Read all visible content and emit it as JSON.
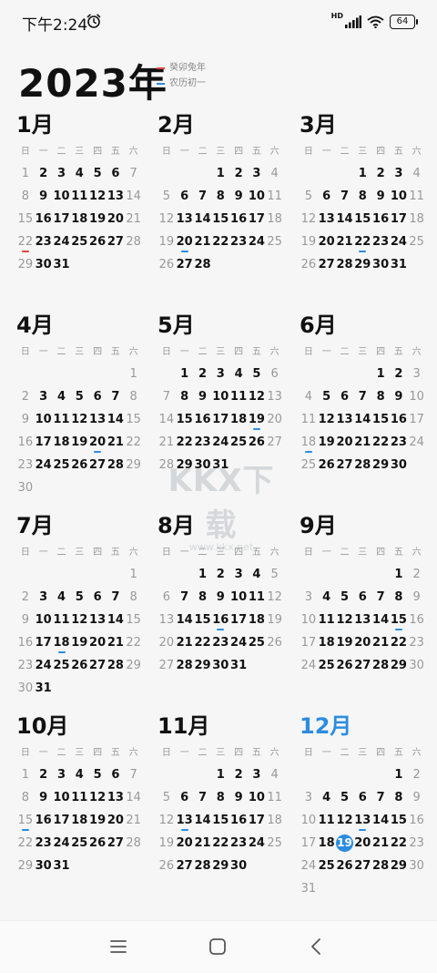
{
  "status_bar": {
    "time": "下午2:24",
    "network_badge": "HD",
    "battery": "64",
    "icons": [
      "alarm-clock-icon",
      "signal-icon",
      "wifi-icon",
      "battery-icon"
    ]
  },
  "header": {
    "year_title": "2023年",
    "legend": [
      {
        "label": "癸卯兔年",
        "color": "#e0463f"
      },
      {
        "label": "农历初一",
        "color": "#2a8de0"
      }
    ]
  },
  "weekday_labels": [
    "日",
    "一",
    "二",
    "三",
    "四",
    "五",
    "六"
  ],
  "colors": {
    "accent": "#2a8de0",
    "holiday_marker": "#e0463f",
    "lunar_marker": "#2a8de0"
  },
  "today": {
    "month": 12,
    "day": 19
  },
  "months": [
    {
      "title": "1月",
      "first_weekday": 0,
      "days": 31,
      "underlined": [
        {
          "day": 22,
          "color": "#e0463f"
        }
      ]
    },
    {
      "title": "2月",
      "first_weekday": 3,
      "days": 28,
      "underlined": [
        {
          "day": 20,
          "color": "#2a8de0"
        }
      ]
    },
    {
      "title": "3月",
      "first_weekday": 3,
      "days": 31,
      "underlined": [
        {
          "day": 22,
          "color": "#2a8de0"
        }
      ]
    },
    {
      "title": "4月",
      "first_weekday": 6,
      "days": 30,
      "underlined": [
        {
          "day": 20,
          "color": "#2a8de0"
        }
      ]
    },
    {
      "title": "5月",
      "first_weekday": 1,
      "days": 31,
      "underlined": [
        {
          "day": 19,
          "color": "#2a8de0"
        }
      ]
    },
    {
      "title": "6月",
      "first_weekday": 4,
      "days": 30,
      "underlined": [
        {
          "day": 18,
          "color": "#2a8de0"
        }
      ]
    },
    {
      "title": "7月",
      "first_weekday": 6,
      "days": 31,
      "underlined": [
        {
          "day": 18,
          "color": "#2a8de0"
        }
      ]
    },
    {
      "title": "8月",
      "first_weekday": 2,
      "days": 31,
      "underlined": [
        {
          "day": 16,
          "color": "#2a8de0"
        }
      ]
    },
    {
      "title": "9月",
      "first_weekday": 5,
      "days": 30,
      "underlined": [
        {
          "day": 15,
          "color": "#2a8de0"
        }
      ]
    },
    {
      "title": "10月",
      "first_weekday": 0,
      "days": 31,
      "underlined": [
        {
          "day": 15,
          "color": "#2a8de0"
        }
      ]
    },
    {
      "title": "11月",
      "first_weekday": 3,
      "days": 30,
      "underlined": [
        {
          "day": 13,
          "color": "#2a8de0"
        }
      ]
    },
    {
      "title": "12月",
      "first_weekday": 5,
      "days": 31,
      "underlined": [
        {
          "day": 13,
          "color": "#2a8de0"
        }
      ],
      "current": true
    }
  ],
  "watermark": {
    "logo_text": "KKX下载",
    "url_text": "www.kkx.net"
  },
  "nav_bar": {
    "buttons": [
      "menu-icon",
      "home-icon",
      "back-icon"
    ]
  }
}
